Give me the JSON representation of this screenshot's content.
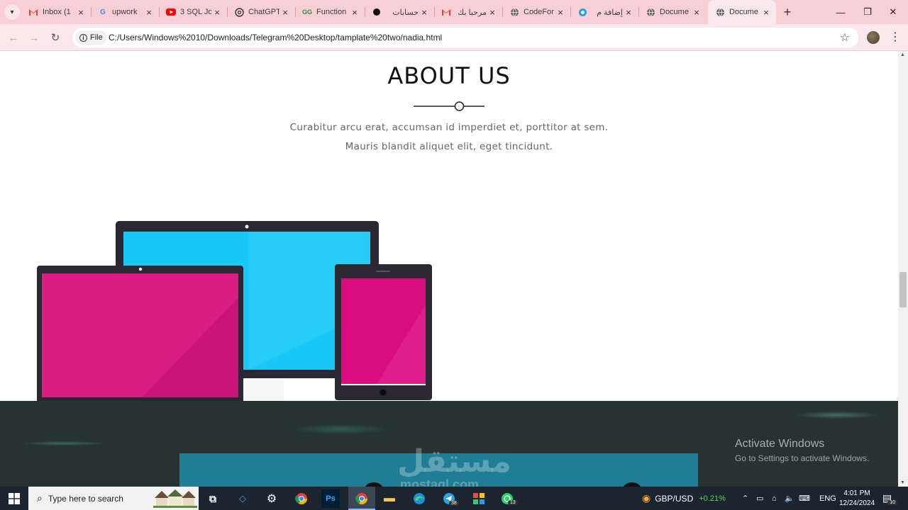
{
  "browser": {
    "tabs": [
      {
        "title": "Inbox (1",
        "icon": "gmail-icon"
      },
      {
        "title": "upwork",
        "icon": "google-icon"
      },
      {
        "title": "3 SQL Jo",
        "icon": "youtube-icon"
      },
      {
        "title": "ChatGPT",
        "icon": "chatgpt-icon"
      },
      {
        "title": "Function",
        "icon": "gfg-icon"
      },
      {
        "title": "حسابات",
        "icon": "threads-icon"
      },
      {
        "title": "مرحبا بك",
        "icon": "gmail-icon"
      },
      {
        "title": "CodeFor",
        "icon": "globe-icon"
      },
      {
        "title": "إضافة م",
        "icon": "circle-icon"
      },
      {
        "title": "Docume",
        "icon": "globe-icon"
      },
      {
        "title": "Docume",
        "icon": "globe-icon",
        "active": true
      }
    ],
    "address": {
      "chip": "File",
      "url": "C:/Users/Windows%2010/Downloads/Telegram%20Desktop/tamplate%20two/nadia.html"
    }
  },
  "page": {
    "about": {
      "title": "ABOUT US",
      "line1": "Curabitur arcu erat, accumsan id imperdiet et, porttitor at sem.",
      "line2": "Mauris blandit aliquet elit, eget tincidunt."
    },
    "watermark": {
      "arabic": "مستقل",
      "latin": "mostaql.com"
    },
    "activation": {
      "title": "Activate Windows",
      "subtitle": "Go to Settings to activate Windows."
    }
  },
  "taskbar": {
    "search_placeholder": "Type here to search",
    "telegram_badge": "38",
    "whatsapp_badge": "13",
    "currency": {
      "pair": "GBP/USD",
      "change": "+0.21%"
    },
    "language": "ENG",
    "time": "4:01 PM",
    "date": "12/24/2024",
    "notification_count": "10"
  },
  "colors": {
    "tabstrip": "#f9cfd6",
    "toolbar": "#fbe8ec",
    "screen_blue": "#1ac8f5",
    "screen_magenta": "#d90d7f",
    "device_frame": "#2b2833",
    "dark_section": "#263332",
    "blue_box": "#1f7d95",
    "currency_green": "#5fd35f"
  }
}
